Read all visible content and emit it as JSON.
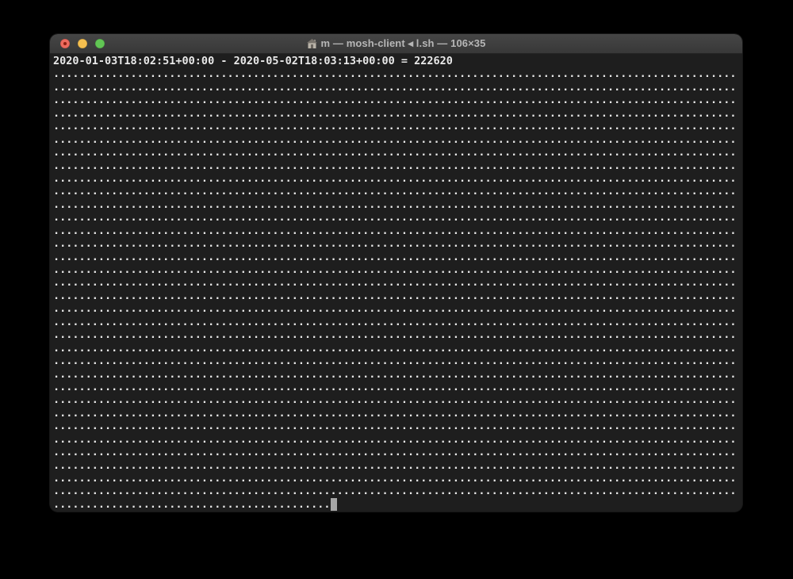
{
  "window": {
    "app": "Terminal",
    "title": "m — mosh-client ◂ l.sh — 106×35",
    "proxy_icon": "home-folder-icon",
    "traffic_lights": {
      "close_label": "close",
      "close_modified": true,
      "minimize_label": "minimize",
      "zoom_label": "zoom"
    }
  },
  "terminal": {
    "header_line": "2020-01-03T18:02:51+00:00 - 2020-05-02T18:03:13+00:00 = 222620",
    "grid": {
      "cols": 106,
      "rows": 35,
      "dot_char": ".",
      "full_dot_rows": 33,
      "last_row_dot_count": 43
    },
    "cursor": {
      "style": "block",
      "row": 35,
      "col": 44
    },
    "colors": {
      "page_background": "#000000",
      "terminal_background": "#1e1e1e",
      "terminal_text": "#e9e9e9",
      "titlebar_text": "#b6b6b6",
      "cursor": "#a6a6a6",
      "light_close": "#ec6a5e",
      "light_close_dot": "#8b1e10",
      "light_minimize": "#f5bf4f",
      "light_zoom": "#61c554"
    }
  }
}
